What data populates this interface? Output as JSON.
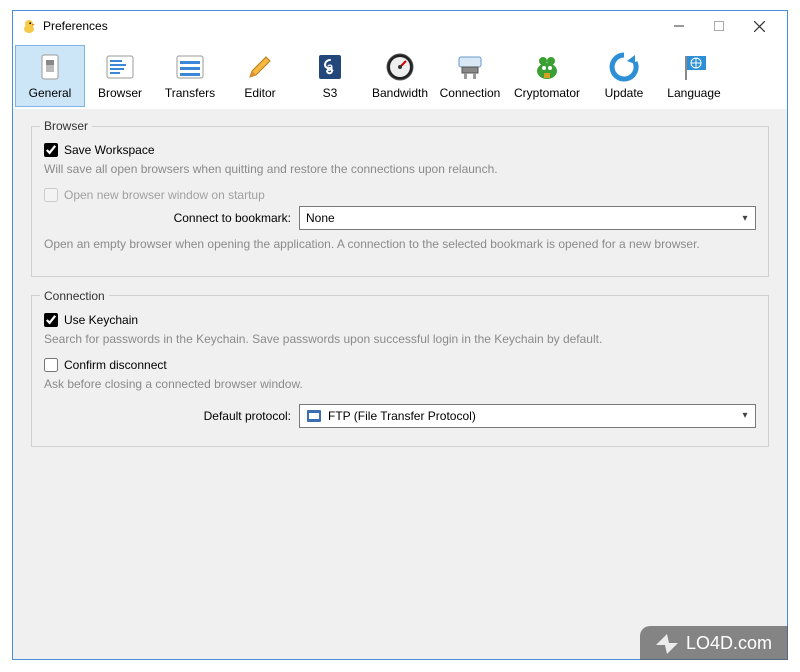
{
  "window": {
    "title": "Preferences"
  },
  "toolbar": {
    "items": [
      {
        "label": "General",
        "icon": "general"
      },
      {
        "label": "Browser",
        "icon": "browser"
      },
      {
        "label": "Transfers",
        "icon": "transfers"
      },
      {
        "label": "Editor",
        "icon": "editor"
      },
      {
        "label": "S3",
        "icon": "s3"
      },
      {
        "label": "Bandwidth",
        "icon": "bandwidth"
      },
      {
        "label": "Connection",
        "icon": "connection"
      },
      {
        "label": "Cryptomator",
        "icon": "cryptomator"
      },
      {
        "label": "Update",
        "icon": "update"
      },
      {
        "label": "Language",
        "icon": "language"
      }
    ]
  },
  "browser_group": {
    "legend": "Browser",
    "save_workspace": "Save Workspace",
    "save_workspace_desc": "Will save all open browsers when quitting and restore the connections upon relaunch.",
    "open_new": "Open new browser window on startup",
    "connect_label": "Connect to bookmark:",
    "connect_value": "None",
    "connect_desc": "Open an empty browser when opening the application. A connection to the selected bookmark is opened for a new browser."
  },
  "connection_group": {
    "legend": "Connection",
    "use_keychain": "Use Keychain",
    "use_keychain_desc": "Search for passwords in the Keychain. Save passwords upon successful login in the Keychain by default.",
    "confirm_disconnect": "Confirm disconnect",
    "confirm_disconnect_desc": "Ask before closing a connected browser window.",
    "default_protocol_label": "Default protocol:",
    "default_protocol_value": "FTP (File Transfer Protocol)"
  },
  "watermark": {
    "text": "LO4D.com"
  }
}
